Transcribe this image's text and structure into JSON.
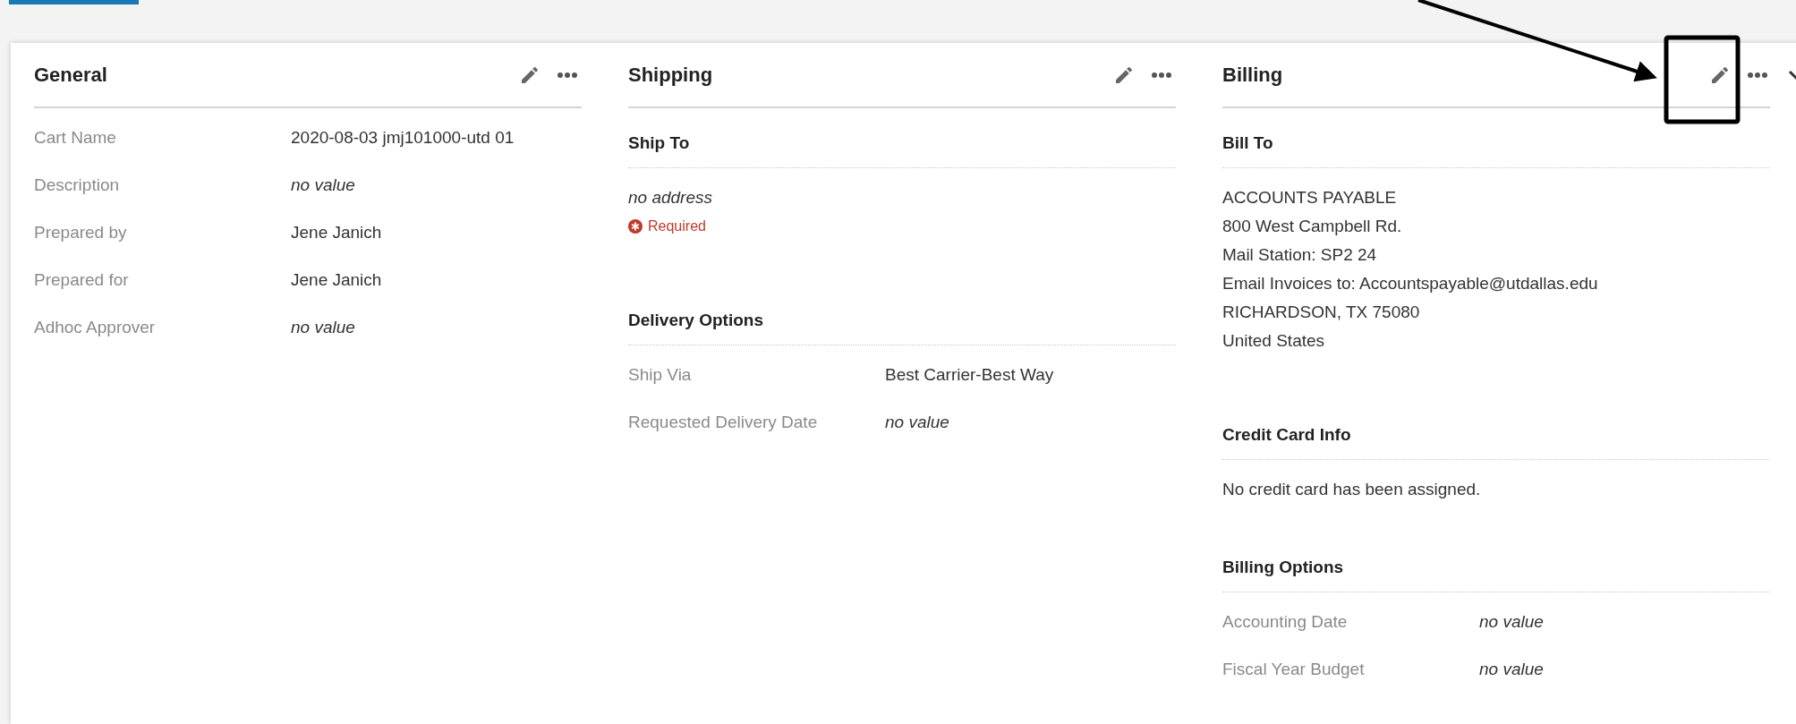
{
  "panels": [
    {
      "title": "General",
      "collapsible": false,
      "blocks": [
        {
          "kind": "fields",
          "rows": [
            {
              "label": "Cart Name",
              "value": "2020-08-03 jmj101000-utd 01",
              "empty": false
            },
            {
              "label": "Description",
              "value": "no value",
              "empty": true
            },
            {
              "label": "Prepared by",
              "value": "Jene Janich",
              "empty": false
            },
            {
              "label": "Prepared for",
              "value": "Jene Janich",
              "empty": false
            },
            {
              "label": "Adhoc Approver",
              "value": "no value",
              "empty": true
            }
          ]
        }
      ]
    },
    {
      "title": "Shipping",
      "collapsible": false,
      "blocks": [
        {
          "kind": "heading",
          "text": "Ship To"
        },
        {
          "kind": "address",
          "empty": true,
          "lines": [
            "no address"
          ],
          "required": "Required"
        },
        {
          "kind": "heading",
          "text": "Delivery Options"
        },
        {
          "kind": "fields",
          "rows": [
            {
              "label": "Ship Via",
              "value": "Best Carrier-Best Way",
              "empty": false
            },
            {
              "label": "Requested Delivery Date",
              "value": "no value",
              "empty": true
            }
          ]
        }
      ]
    },
    {
      "title": "Billing",
      "collapsible": true,
      "blocks": [
        {
          "kind": "heading",
          "text": "Bill To"
        },
        {
          "kind": "address",
          "empty": false,
          "lines": [
            "ACCOUNTS PAYABLE",
            "800 West Campbell Rd.",
            "Mail Station: SP2 24",
            "Email Invoices to: Accountspayable@utdallas.edu",
            "RICHARDSON, TX 75080",
            "United States"
          ]
        },
        {
          "kind": "heading",
          "text": "Credit Card Info"
        },
        {
          "kind": "note",
          "text": "No credit card has been assigned."
        },
        {
          "kind": "heading",
          "text": "Billing Options"
        },
        {
          "kind": "fields",
          "rows": [
            {
              "label": "Accounting Date",
              "value": "no value",
              "empty": true
            },
            {
              "label": "Fiscal Year Budget",
              "value": "no value",
              "empty": true
            }
          ]
        }
      ]
    }
  ]
}
